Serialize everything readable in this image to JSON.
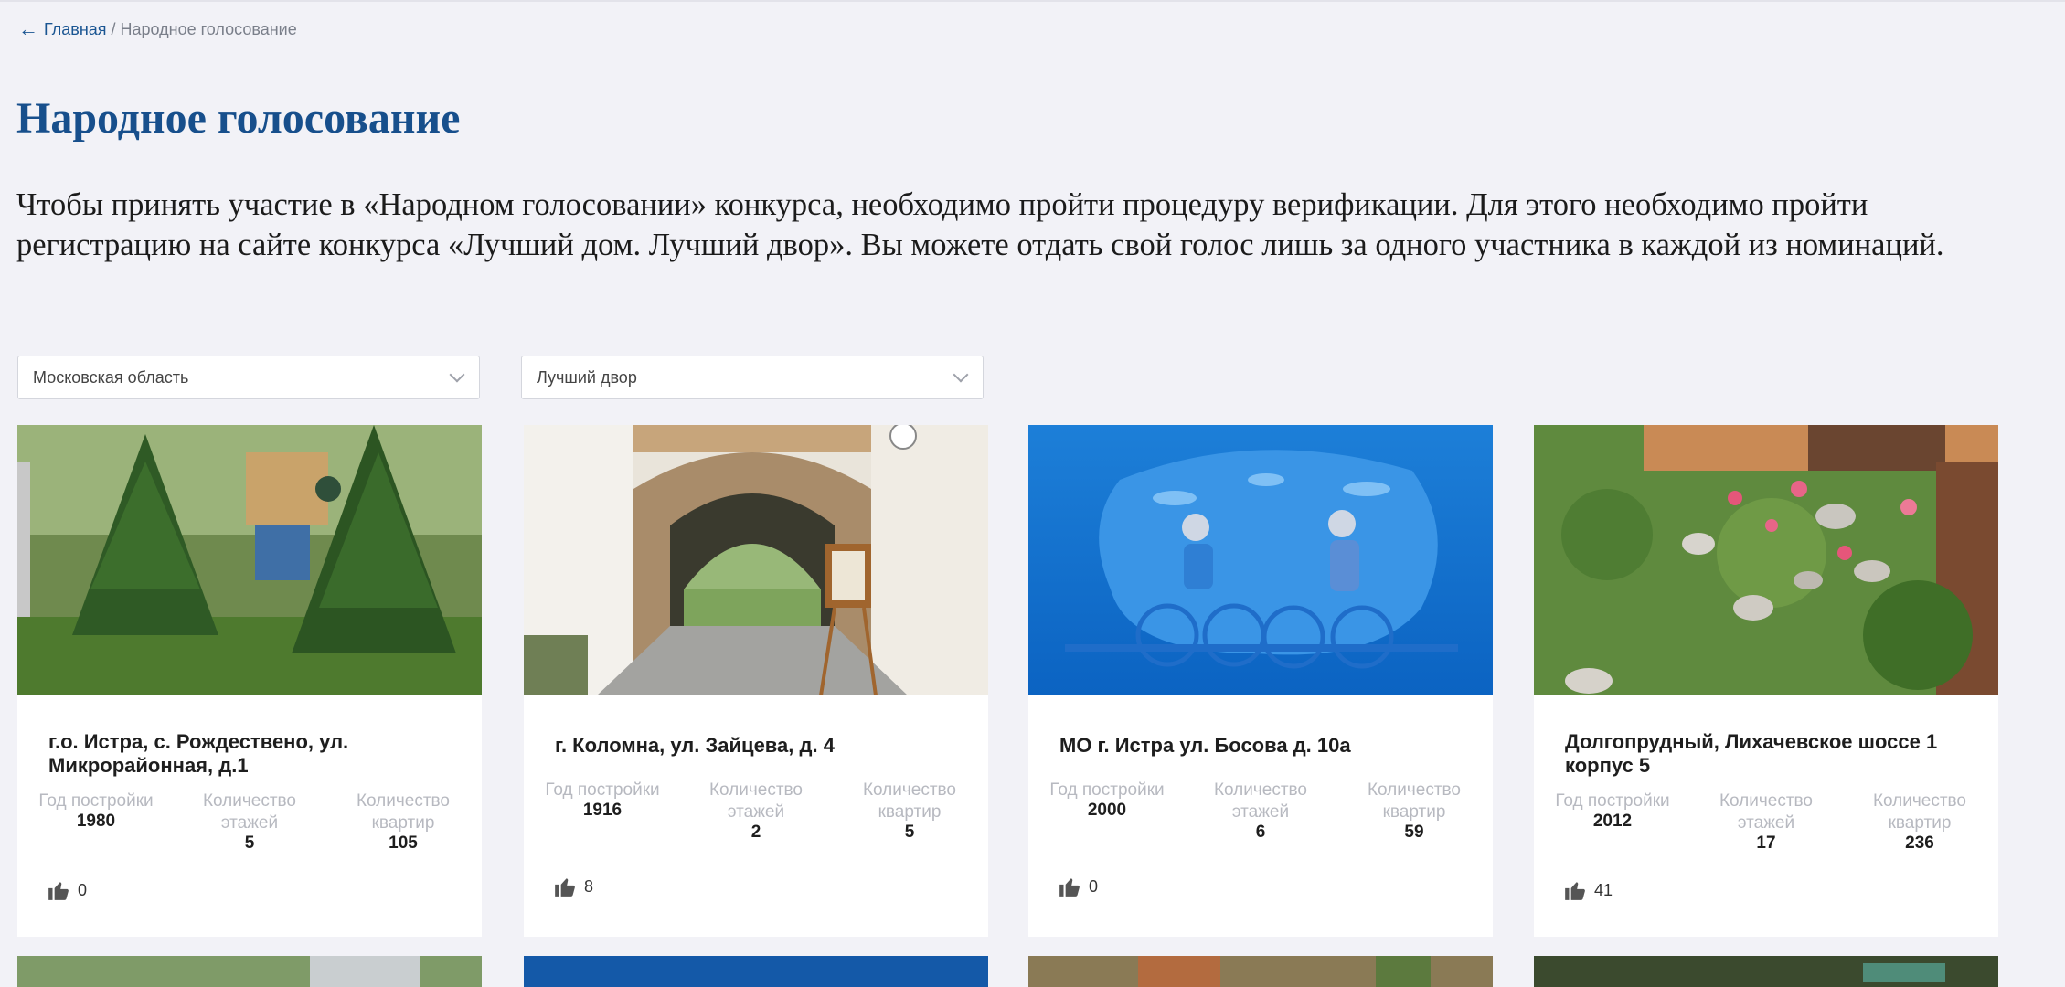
{
  "breadcrumb": {
    "home": "Главная",
    "separator": "/",
    "current": "Народное голосование"
  },
  "page_title": "Народное голосование",
  "intro": "Чтобы принять участие в «Народном голосовании» конкурса, необходимо пройти процедуру верификации. Для этого необходимо пройти регистрацию на сайте конкурса «Лучший дом. Лучший двор». Вы можете отдать свой голос лишь за одного участника в каждой из номинаций.",
  "filters": {
    "region": "Московская область",
    "nomination": "Лучший двор"
  },
  "stat_labels": {
    "year": "Год постройки",
    "floors": "Количество этажей",
    "flats": "Количество квартир"
  },
  "cards": [
    {
      "address": "г.о. Истра, с. Рождествено, ул. Микрорайонная, д.1",
      "year": "1980",
      "floors": "5",
      "flats": "105",
      "likes": "0"
    },
    {
      "address": "г. Коломна, ул. Зайцева, д. 4",
      "year": "1916",
      "floors": "2",
      "flats": "5",
      "likes": "8"
    },
    {
      "address": "МО г. Истра ул. Босова д. 10а",
      "year": "2000",
      "floors": "6",
      "flats": "59",
      "likes": "0"
    },
    {
      "address": "Долгопрудный, Лихачевское шоссе 1 корпус 5",
      "year": "2012",
      "floors": "17",
      "flats": "236",
      "likes": "41"
    }
  ],
  "icons": {
    "back": "arrow-left-icon",
    "dropdown": "chevron-down-icon",
    "like": "thumbs-up-icon"
  },
  "colors": {
    "accent": "#174f8c",
    "link": "#1a5592",
    "background": "#f2f2f7"
  }
}
